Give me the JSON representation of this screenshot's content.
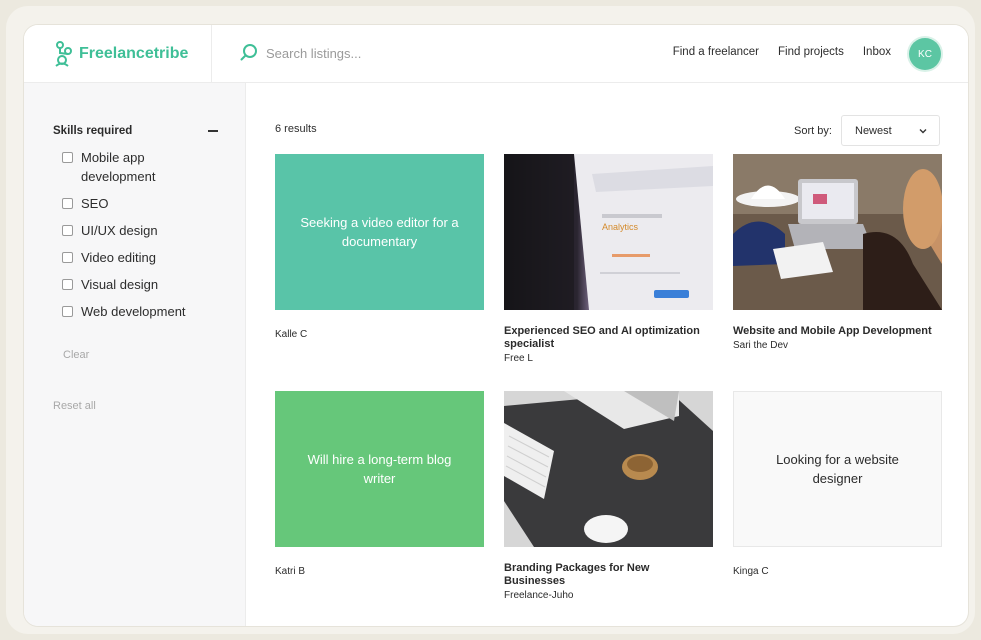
{
  "header": {
    "brand": "Freelancetribe",
    "search_placeholder": "Search listings...",
    "nav": [
      "Find a freelancer",
      "Find projects",
      "Inbox"
    ],
    "avatar_initials": "KC",
    "accent_color": "#3fbf97"
  },
  "sidebar": {
    "filter_title": "Skills required",
    "options": [
      "Mobile app development",
      "SEO",
      "UI/UX design",
      "Video editing",
      "Visual design",
      "Web development"
    ],
    "clear_label": "Clear",
    "reset_label": "Reset all"
  },
  "main": {
    "results_count": "6 results",
    "sort_label": "Sort by:",
    "sort_value": "Newest",
    "listings": [
      {
        "thumb_text": "Seeking a video editor for a documentary",
        "title": "",
        "author": "Kalle C"
      },
      {
        "thumb_text": "",
        "title": "Experienced SEO and AI optimization specialist",
        "author": "Free L"
      },
      {
        "thumb_text": "",
        "title": "Website and Mobile App Development",
        "author": "Sari the Dev"
      },
      {
        "thumb_text": "Will hire a long-term blog writer",
        "title": "",
        "author": "Katri B"
      },
      {
        "thumb_text": "",
        "title": "Branding Packages for New Businesses",
        "author": "Freelance-Juho"
      },
      {
        "thumb_text": "Looking for a website designer",
        "title": "",
        "author": "Kinga C"
      }
    ],
    "photo_texts": {
      "analytics": "Analytics"
    }
  }
}
